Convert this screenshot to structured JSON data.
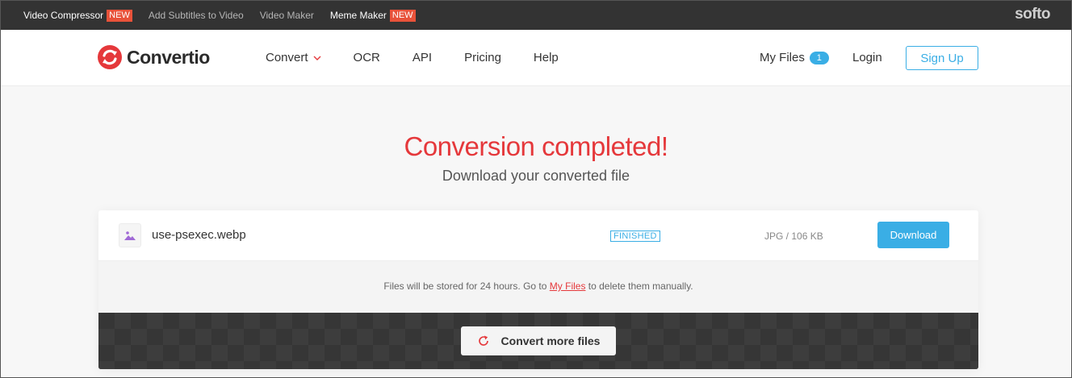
{
  "topbar": {
    "links": [
      {
        "label": "Video Compressor",
        "badge": "NEW"
      },
      {
        "label": "Add Subtitles to Video"
      },
      {
        "label": "Video Maker"
      },
      {
        "label": "Meme Maker",
        "badge": "NEW"
      }
    ],
    "brand": "softo"
  },
  "header": {
    "logo_text": "Convertio",
    "nav": [
      "Convert",
      "OCR",
      "API",
      "Pricing",
      "Help"
    ],
    "my_files_label": "My Files",
    "my_files_count": "1",
    "login_label": "Login",
    "signup_label": "Sign Up"
  },
  "main": {
    "title": "Conversion completed!",
    "subtitle": "Download your converted file",
    "file": {
      "name": "use-psexec.webp",
      "status": "FINISHED",
      "info": "JPG / 106 KB",
      "download_label": "Download"
    },
    "notice_before": "Files will be stored for 24 hours. Go to ",
    "notice_link": "My Files",
    "notice_after": " to delete them manually.",
    "convert_more_label": "Convert more files"
  },
  "colors": {
    "accent_red": "#e5383b",
    "accent_blue": "#3aaee5",
    "topbar_bg": "#333333",
    "new_badge": "#e8523a"
  },
  "icons": [
    "convertio-logo",
    "chevron-down-icon",
    "image-file-icon",
    "refresh-icon"
  ]
}
